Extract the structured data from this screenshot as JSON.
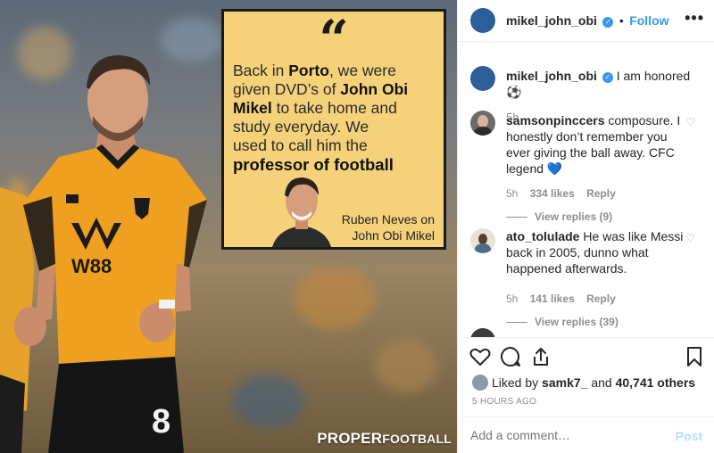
{
  "post": {
    "author": "mikel_john_obi",
    "follow_label": "Follow",
    "separator": "•",
    "more_label": "•••"
  },
  "media": {
    "quote_mark": "“",
    "quote_lines": [
      {
        "pre": "Back in ",
        "bold": "Porto",
        "post": ", we were"
      },
      {
        "pre": "given DVD’s of ",
        "bold": "John Obi",
        "post": ""
      },
      {
        "pre": "",
        "bold": "Mikel",
        "post": " to take home and"
      },
      {
        "pre": "study everyday. We",
        "bold": "",
        "post": ""
      },
      {
        "pre": "used to call him the",
        "bold": "",
        "post": ""
      },
      {
        "pre": "",
        "bold": "professor of football",
        "post": ""
      }
    ],
    "attribution_line1": "Ruben Neves on",
    "attribution_line2": "John Obi Mikel",
    "brand_part1": "PROPER",
    "brand_part2": "FOOTBALL",
    "shirt_sponsor": "W88",
    "shirt_number": "8"
  },
  "caption": {
    "author": "mikel_john_obi",
    "text": "I am honored ⚽",
    "time": "5h"
  },
  "comments": [
    {
      "author": "samsonpinccers",
      "text": "composure. I honestly don’t remember you ever giving the ball away. CFC legend 💙",
      "time": "5h",
      "likes": "334 likes",
      "reply_label": "Reply",
      "view_replies": "View replies (9)"
    },
    {
      "author": "ato_tolulade",
      "text": "He was like Messi back in 2005, dunno what happened afterwards.",
      "time": "5h",
      "likes": "141 likes",
      "reply_label": "Reply",
      "view_replies": "View replies (39)"
    }
  ],
  "likes_line": {
    "prefix": "Liked by ",
    "user": "samk7_",
    "middle": " and ",
    "count": "40,741 others"
  },
  "timestamp": "5 HOURS AGO",
  "composer": {
    "placeholder": "Add a comment…",
    "post_label": "Post"
  },
  "colors": {
    "accent": "#3897f0",
    "muted": "#8e8e8e",
    "quote_bg": "#f5d27a",
    "jersey": "#f0a020"
  }
}
